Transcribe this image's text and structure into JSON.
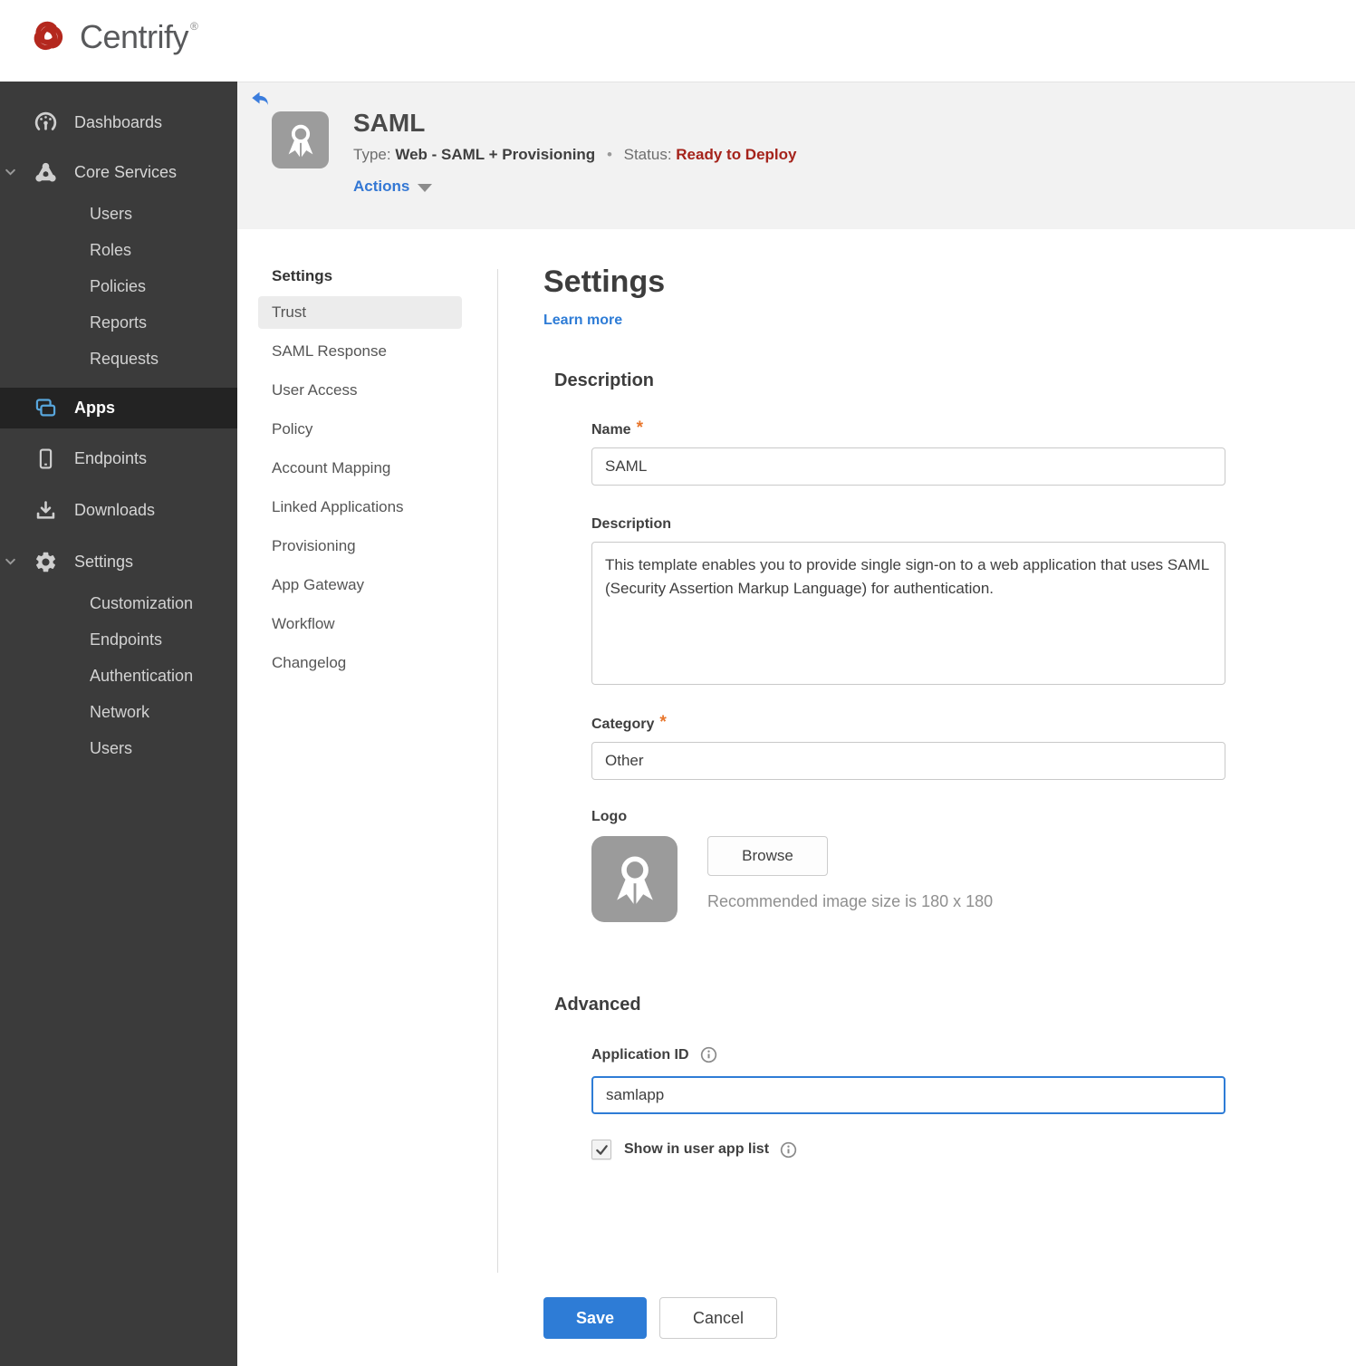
{
  "brand": {
    "name": "Centrify",
    "trademark": "®",
    "logo_color": "#b4281e"
  },
  "sidebar": {
    "items": [
      {
        "label": "Dashboards",
        "icon": "gauge-icon"
      },
      {
        "label": "Core Services",
        "icon": "core-services-icon",
        "expanded": true,
        "children": [
          "Users",
          "Roles",
          "Policies",
          "Reports",
          "Requests"
        ]
      },
      {
        "label": "Apps",
        "icon": "apps-icon",
        "active": true
      },
      {
        "label": "Endpoints",
        "icon": "phone-icon"
      },
      {
        "label": "Downloads",
        "icon": "download-icon"
      },
      {
        "label": "Settings",
        "icon": "gear-icon",
        "expanded": true,
        "children": [
          "Customization",
          "Endpoints",
          "Authentication",
          "Network",
          "Users"
        ]
      }
    ]
  },
  "header": {
    "title": "SAML",
    "type_label": "Type:",
    "type_value": "Web - SAML + Provisioning",
    "separator": "•",
    "status_label": "Status:",
    "status_value": "Ready to Deploy",
    "status_color": "#a5231b",
    "actions_label": "Actions",
    "app_icon": "ribbon-icon",
    "back_icon": "back-arrow-icon"
  },
  "subnav": {
    "heading": "Settings",
    "active_item": "Trust",
    "items": [
      "Trust",
      "SAML Response",
      "User Access",
      "Policy",
      "Account Mapping",
      "Linked Applications",
      "Provisioning",
      "App Gateway",
      "Workflow",
      "Changelog"
    ]
  },
  "main": {
    "heading": "Settings",
    "learn_more_label": "Learn more",
    "required_marker": "*",
    "description": {
      "heading": "Description",
      "name_label": "Name",
      "name_value": "SAML",
      "description_label": "Description",
      "description_value": "This template enables you to provide single sign-on to a web application that uses SAML (Security Assertion Markup Language) for authentication.",
      "category_label": "Category",
      "category_value": "Other",
      "logo_label": "Logo",
      "logo_icon": "ribbon-icon",
      "browse_label": "Browse",
      "logo_hint": "Recommended image size is 180 x 180"
    },
    "advanced": {
      "heading": "Advanced",
      "application_id_label": "Application ID",
      "application_id_value": "samlapp",
      "application_id_focused": true,
      "show_in_user_app_list_label": "Show in user app list",
      "show_in_user_app_list_checked": true,
      "info_icon": "info-icon"
    },
    "buttons": {
      "save": "Save",
      "cancel": "Cancel"
    }
  },
  "colors": {
    "accent_blue": "#2e7cd6",
    "status_red": "#a5231b",
    "sidebar_bg": "#3b3b3b",
    "sidebar_active_bg": "#232323",
    "header_bg": "#f2f2f2",
    "brand_red": "#b4281e"
  }
}
